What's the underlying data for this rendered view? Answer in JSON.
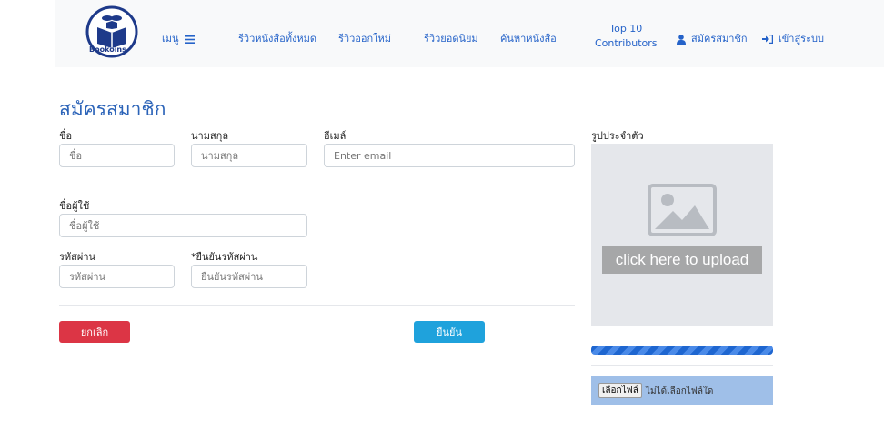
{
  "navbar": {
    "logo_text": "Bookoins",
    "menu": "เมนู",
    "items": [
      "รีวิวหนังสือทั้งหมด",
      "รีวิวออกใหม่",
      "รีวิวยอดนิยม",
      "ค้นหาหนังสือ"
    ],
    "top10_line1": "Top 10",
    "top10_line2": "Contributors",
    "register": "สมัครสมาชิก",
    "login": "เข้าสู่ระบบ"
  },
  "form": {
    "title": "สมัครสมาชิก",
    "first_name": {
      "label": "ชื่อ",
      "placeholder": "ชื่อ"
    },
    "last_name": {
      "label": "นามสกุล",
      "placeholder": "นามสกุล"
    },
    "email": {
      "label": "อีเมล์",
      "placeholder": "Enter email"
    },
    "username": {
      "label": "ชื่อผู้ใช้",
      "placeholder": "ชื่อผู้ใช้"
    },
    "password": {
      "label": "รหัสผ่าน",
      "placeholder": "รหัสผ่าน"
    },
    "confirm_password": {
      "label": "*ยืนยันรหัสผ่าน",
      "placeholder": "ยืนยันรหัสผ่าน"
    },
    "cancel_label": "ยกเลิก",
    "confirm_label": "ยืนยัน"
  },
  "upload": {
    "label": "รูปประจำตัว",
    "hint": "click here to upload",
    "progress_percent": 100,
    "file_button": "เลือกไฟล์",
    "file_status": "ไม่ได้เลือกไฟล์ใด"
  },
  "colors": {
    "accent": "#2563c9",
    "danger": "#dc3545",
    "info": "#1fa2dc"
  }
}
